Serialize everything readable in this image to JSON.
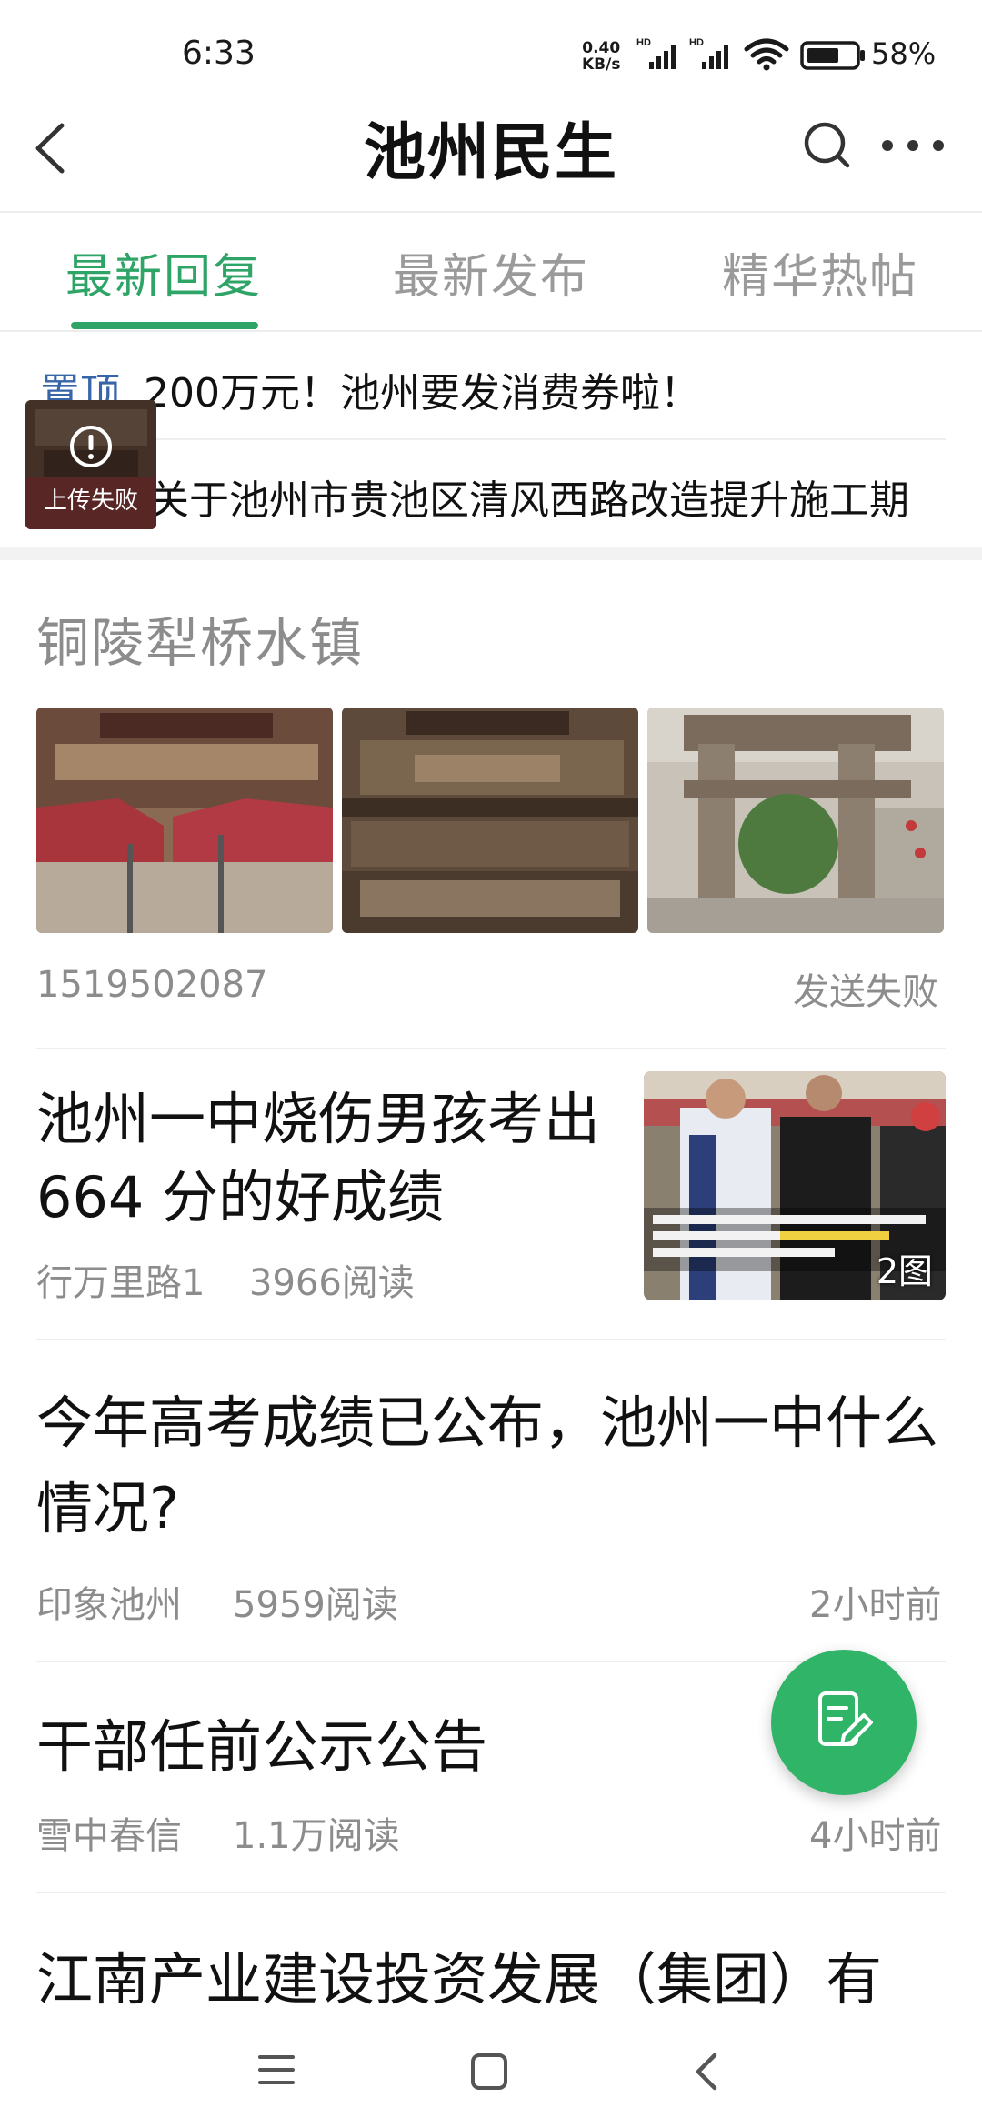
{
  "status_bar": {
    "time": "6:33",
    "net_speed_value": "0.40",
    "net_speed_unit": "KB/s",
    "battery": "58%"
  },
  "header": {
    "title": "池州民生",
    "icons": [
      "back-icon",
      "search-icon",
      "more-icon"
    ]
  },
  "tabs": [
    {
      "label": "最新回复",
      "active": true
    },
    {
      "label": "最新发布",
      "active": false
    },
    {
      "label": "精华热帖",
      "active": false
    }
  ],
  "pinned": {
    "tag": "置顶",
    "items": [
      {
        "title": "200万元！池州要发消费券啦！"
      },
      {
        "title": "关于池州市贵池区清风西路改造提升施工期"
      }
    ]
  },
  "upload_overlay": {
    "text": "上传失败"
  },
  "posts": [
    {
      "title": "铜陵犁桥水镇",
      "author": "1519502087",
      "status": "发送失败"
    },
    {
      "title": "池州一中烧伤男孩考出 664 分的好成绩",
      "author": "行万里路1",
      "reads": "3966阅读",
      "image_count": "2图"
    },
    {
      "title": "今年高考成绩已公布，池州一中什么情况?",
      "author": "印象池州",
      "reads": "5959阅读",
      "time": "2小时前"
    },
    {
      "title": "干部任前公示公告",
      "author": "雪中春信",
      "reads": "1.1万阅读",
      "time": "4小时前"
    },
    {
      "title": "江南产业建设投资发展（集团）有"
    }
  ],
  "colors": {
    "accent": "#2fa467",
    "fab": "#2fb468",
    "pin_tag": "#3665a8",
    "meta_text": "#8c8c8c"
  },
  "nav_bar": {
    "icons": [
      "menu-icon",
      "home-icon",
      "back-nav-icon"
    ]
  }
}
